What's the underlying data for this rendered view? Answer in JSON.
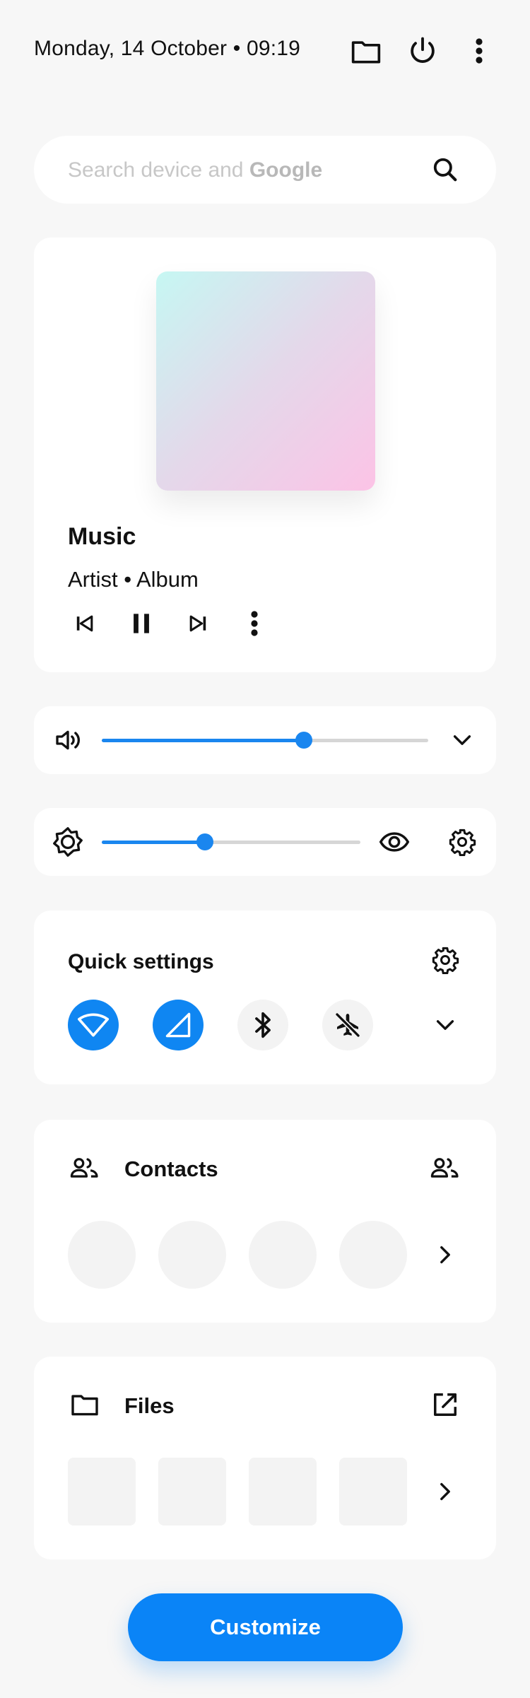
{
  "header": {
    "datetime": "Monday, 14 October • 09:19",
    "icons": [
      "folder-icon",
      "power-icon",
      "more-vert-icon"
    ]
  },
  "search": {
    "placeholder_prefix": "Search device and ",
    "placeholder_brand": "Google",
    "icon": "search-icon"
  },
  "music": {
    "title": "Music",
    "subtitle": "Artist • Album",
    "controls": [
      "skip-previous-icon",
      "pause-icon",
      "skip-next-icon",
      "more-vert-icon"
    ]
  },
  "volume": {
    "level": 0.62,
    "icon": "volume-icon",
    "expand_icon": "chevron-down-icon"
  },
  "brightness": {
    "level": 0.4,
    "icon": "brightness-icon",
    "extra_icons": [
      "eye-icon",
      "gear-icon"
    ]
  },
  "quick_settings": {
    "title": "Quick settings",
    "toggles": [
      {
        "name": "wifi",
        "on": true
      },
      {
        "name": "mobile-data",
        "on": true
      },
      {
        "name": "bluetooth",
        "on": false
      },
      {
        "name": "airplane-mode",
        "on": false
      }
    ]
  },
  "contacts": {
    "title": "Contacts",
    "placeholder_count": 4
  },
  "files": {
    "title": "Files",
    "placeholder_count": 4
  },
  "customize_button": {
    "label": "Customize"
  },
  "colors": {
    "accent": "#0a84f7",
    "background": "#f7f7f7",
    "card": "#ffffff",
    "placeholder": "#f3f3f3"
  }
}
